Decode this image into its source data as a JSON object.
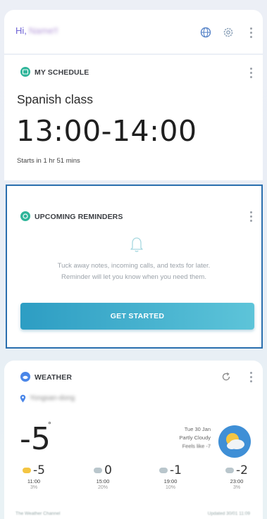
{
  "header": {
    "greeting": "Hi,",
    "user_name": "Name!!",
    "icons": [
      "globe-icon",
      "gear-icon",
      "more-icon"
    ]
  },
  "schedule": {
    "title": "MY SCHEDULE",
    "event_name": "Spanish class",
    "event_time": "13:00-14:00",
    "starts_text": "Starts in 1 hr 51 mins",
    "accent": "#2fb59a"
  },
  "reminders": {
    "title": "UPCOMING REMINDERS",
    "description_line1": "Tuck away notes, incoming calls, and texts for later.",
    "description_line2": "Reminder will let you know when you need them.",
    "button_label": "GET STARTED",
    "accent": "#2fb59a"
  },
  "weather": {
    "title": "WEATHER",
    "location": "Yongsan-dong",
    "current_temp": "-5",
    "degree_symbol": "°",
    "date": "Tue 30 Jan",
    "condition": "Partly Cloudy",
    "feels_like": "Feels like -7",
    "accent": "#4a86e8",
    "forecast": [
      {
        "temp": "-5",
        "time": "11:00",
        "precip": "3%"
      },
      {
        "temp": "0",
        "time": "15:00",
        "precip": "20%"
      },
      {
        "temp": "-1",
        "time": "19:00",
        "precip": "10%"
      },
      {
        "temp": "-2",
        "time": "23:00",
        "precip": "3%"
      }
    ],
    "footer_source": "The Weather Channel",
    "footer_updated": "Updated 30/01 11:09"
  }
}
